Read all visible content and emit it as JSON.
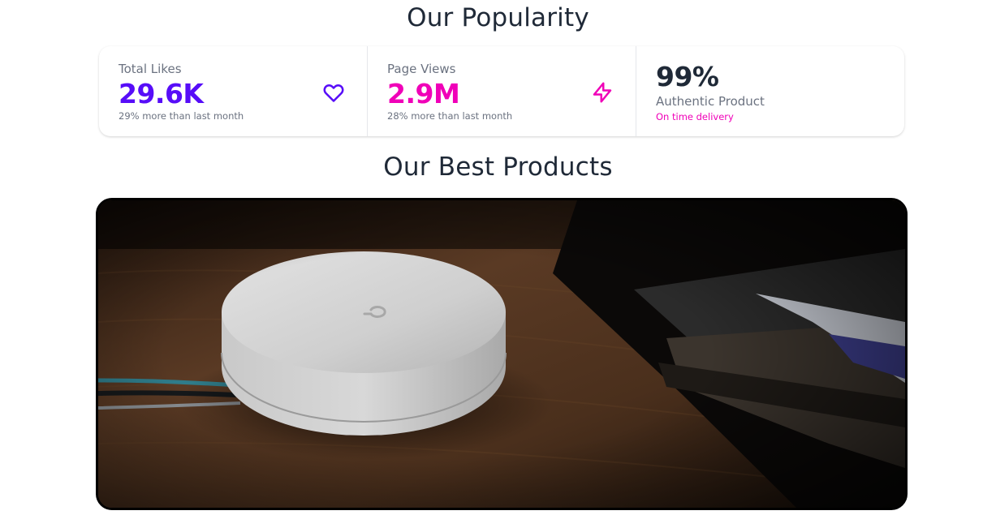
{
  "popularity": {
    "title": "Our Popularity"
  },
  "stats": [
    {
      "label": "Total Likes",
      "value": "29.6K",
      "description": "29% more than last month",
      "icon": "heart-icon",
      "value_color": "#570df8"
    },
    {
      "label": "Page Views",
      "value": "2.9M",
      "description": "28% more than last month",
      "icon": "lightning-bolt-icon",
      "value_color": "#f000b8"
    },
    {
      "value": "99%",
      "label": "Authentic Product",
      "description": "On time delivery",
      "value_color": "#1f2937",
      "description_color": "#f000b8"
    }
  ],
  "products": {
    "title": "Our Best Products",
    "image": "white-mesh-wifi-router-on-wooden-desk"
  },
  "colors": {
    "primary": "#570df8",
    "secondary": "#f000b8",
    "text": "#1f2937",
    "muted": "#6b7280"
  }
}
